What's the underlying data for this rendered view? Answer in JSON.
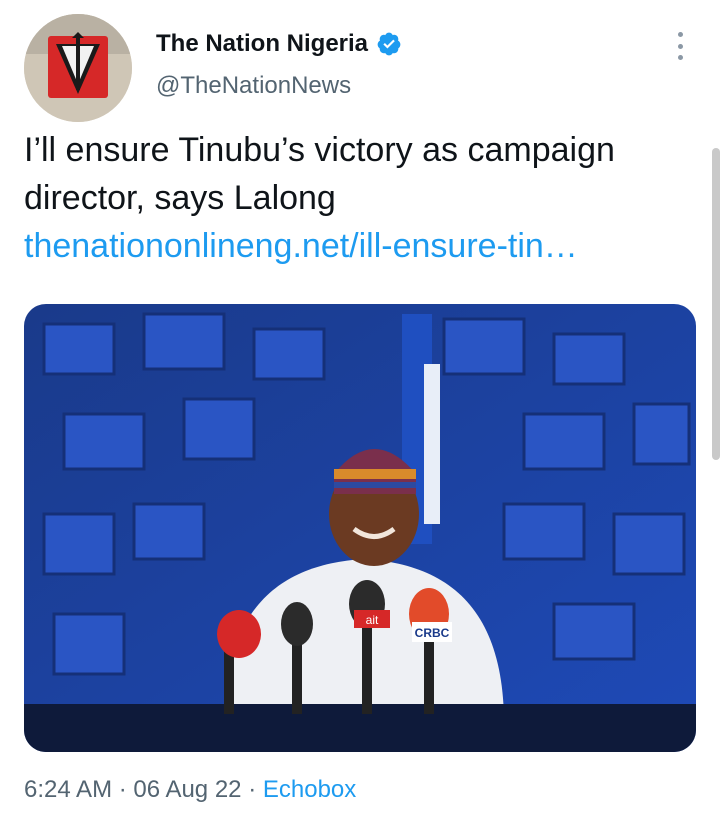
{
  "author": {
    "name": "The Nation Nigeria",
    "handle": "@TheNationNews",
    "verified": true,
    "verified_color": "#1d9bf0"
  },
  "tweet": {
    "text": "I’ll ensure Tinubu’s victory as campaign director, says Lalong",
    "link": "thenationonlineng.net/ill-ensure-tin…",
    "media": {
      "mic_labels": [
        "CRBC",
        "ait"
      ]
    }
  },
  "meta": {
    "time": "6:24 AM",
    "separator": "·",
    "date": "06 Aug 22",
    "source": "Echobox"
  },
  "icons": {
    "more": "more-vertical-icon",
    "verified": "verified-badge-icon"
  }
}
